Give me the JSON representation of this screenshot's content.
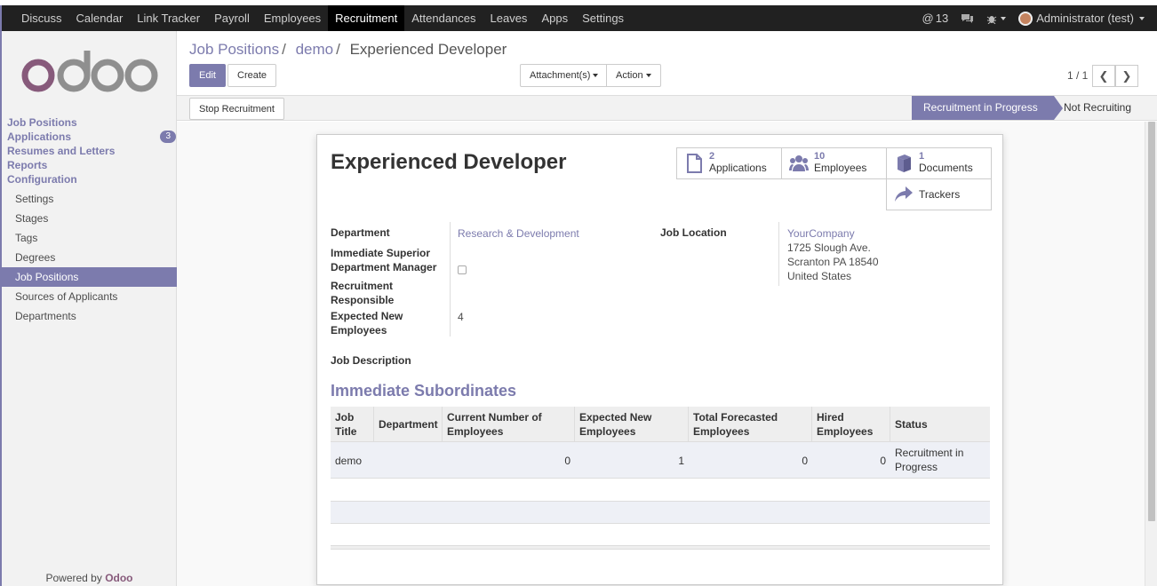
{
  "topnav": {
    "items": [
      "Discuss",
      "Calendar",
      "Link Tracker",
      "Payroll",
      "Employees",
      "Recruitment",
      "Attendances",
      "Leaves",
      "Apps",
      "Settings"
    ],
    "active": "Recruitment",
    "notif_count": "13",
    "user": "Administrator (test)"
  },
  "sidebar": {
    "logo": "odoo",
    "main_items": [
      "Job Positions",
      "Applications",
      "Resumes and Letters",
      "Reports",
      "Configuration"
    ],
    "applications_badge": "3",
    "config_items": [
      "Settings",
      "Stages",
      "Tags",
      "Degrees",
      "Job Positions",
      "Sources of Applicants",
      "Departments"
    ],
    "active_config": "Job Positions",
    "powered_by": "Powered by",
    "powered_brand": "Odoo"
  },
  "breadcrumb": [
    "Job Positions",
    "demo",
    "Experienced Developer"
  ],
  "buttons": {
    "edit": "Edit",
    "create": "Create",
    "attachments": "Attachment(s)",
    "action": "Action",
    "stop_recruitment": "Stop Recruitment"
  },
  "pager": "1 / 1",
  "stages": {
    "active": "Recruitment in Progress",
    "other": "Not Recruiting"
  },
  "record": {
    "title": "Experienced Developer",
    "smart_buttons": [
      {
        "count": "2",
        "label": "Applications",
        "icon": "file-icon"
      },
      {
        "count": "10",
        "label": "Employees",
        "icon": "users-icon"
      },
      {
        "count": "1",
        "label": "Documents",
        "icon": "book-icon"
      },
      {
        "count": "",
        "label": "Trackers",
        "icon": "share-icon"
      }
    ],
    "fields": {
      "department_label": "Department",
      "department_value": "Research & Development",
      "superior_label": "Immediate Superior Department Manager",
      "responsible_label": "Recruitment Responsible",
      "expected_label": "Expected New Employees",
      "expected_value": "4",
      "job_location_label": "Job Location",
      "company": "YourCompany",
      "address_line1": "1725 Slough Ave.",
      "address_line2": "Scranton PA 18540",
      "address_line3": "United States",
      "job_description_label": "Job Description"
    },
    "subordinates": {
      "title": "Immediate Subordinates",
      "columns": [
        "Job Title",
        "Department",
        "Current Number of Employees",
        "Expected New Employees",
        "Total Forecasted Employees",
        "Hired Employees",
        "Status"
      ],
      "rows": [
        {
          "job_title": "demo",
          "department": "",
          "current": "0",
          "expected": "1",
          "forecast": "0",
          "hired": "0",
          "status": "Recruitment in Progress"
        }
      ]
    }
  },
  "colors": {
    "accent": "#7c7bad",
    "brand": "#875a7b",
    "topbar": "#212121"
  }
}
